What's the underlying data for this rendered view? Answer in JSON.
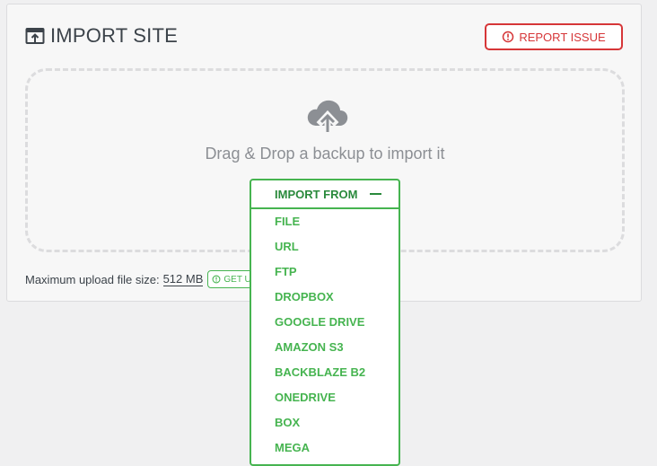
{
  "header": {
    "title": "IMPORT SITE",
    "report_label": "REPORT ISSUE"
  },
  "dropzone": {
    "text": "Drag & Drop a backup to import it"
  },
  "upload": {
    "label": "Maximum upload file size:",
    "size": "512 MB",
    "get_label": "GET U"
  },
  "import": {
    "label": "IMPORT FROM",
    "items": [
      "FILE",
      "URL",
      "FTP",
      "DROPBOX",
      "GOOGLE DRIVE",
      "AMAZON S3",
      "BACKBLAZE B2",
      "ONEDRIVE",
      "BOX",
      "MEGA"
    ]
  },
  "colors": {
    "accent_green": "#46b450",
    "danger_red": "#d63638"
  },
  "icons": [
    "import-site-icon",
    "warning-circle-icon",
    "cloud-upload-icon",
    "minus-icon"
  ]
}
